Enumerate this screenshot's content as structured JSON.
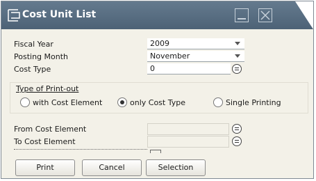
{
  "window": {
    "title": "Cost Unit List"
  },
  "title_controls": {
    "minimize_icon": "minimize-icon",
    "close_icon": "close-icon"
  },
  "fields": {
    "fiscal_year": {
      "label": "Fiscal Year",
      "value": "2009"
    },
    "posting_month": {
      "label": "Posting Month",
      "value": "November"
    },
    "cost_type": {
      "label": "Cost Type",
      "value": "0"
    },
    "from_cost_element": {
      "label": "From Cost Element",
      "value": ""
    },
    "to_cost_element": {
      "label": "To Cost Element",
      "value": ""
    }
  },
  "print_type": {
    "title": "Type of Print-out",
    "options": [
      {
        "label": "with Cost Element",
        "selected": false
      },
      {
        "label": "only Cost Type",
        "selected": true
      },
      {
        "label": "Single Printing",
        "selected": false
      }
    ]
  },
  "buttons": {
    "print": "Print",
    "cancel": "Cancel",
    "selection": "Selection"
  },
  "colors": {
    "titlebar": "#5a6e82",
    "window_bg": "#f3f1e8"
  }
}
